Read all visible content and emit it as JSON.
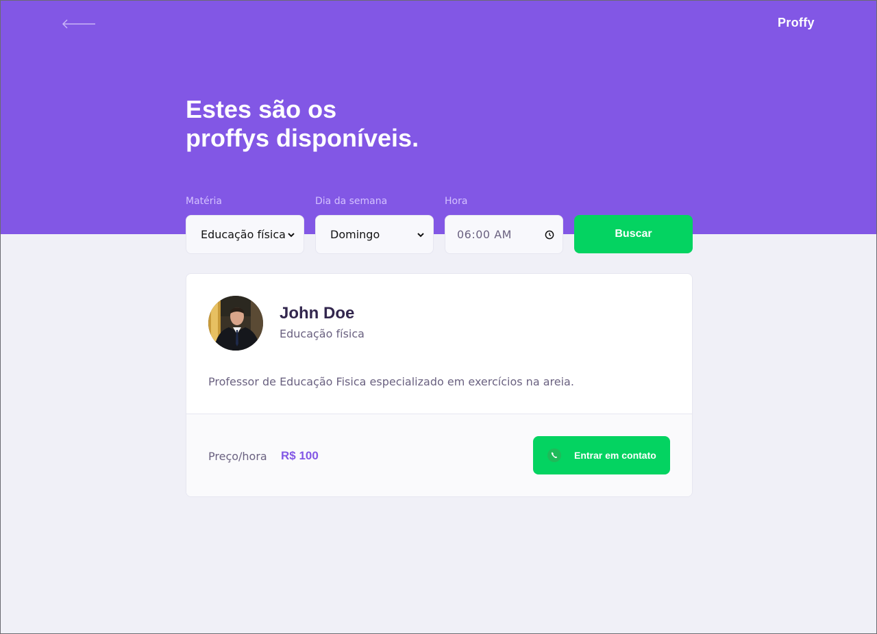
{
  "header": {
    "logo": "Proffy",
    "title_line1": "Estes são os",
    "title_line2": "proffys disponíveis."
  },
  "search": {
    "subject_label": "Matéria",
    "subject_value": "Educação física",
    "weekday_label": "Dia da semana",
    "weekday_value": "Domingo",
    "time_label": "Hora",
    "time_value": "06:00 AM",
    "button_label": "Buscar"
  },
  "teacher": {
    "name": "John Doe",
    "subject": "Educação física",
    "bio": "Professor de Educação Fisica especializado em exercícios na areia.",
    "price_label": "Preço/hora",
    "price_value": "R$ 100",
    "contact_label": "Entrar em contato"
  },
  "colors": {
    "primary": "#8257E5",
    "secondary": "#04D361",
    "background": "#F0F0F7"
  },
  "icons": {
    "back": "arrow-left-icon",
    "select": "chevron-down-icon",
    "time": "clock-icon",
    "contact": "whatsapp-icon"
  }
}
